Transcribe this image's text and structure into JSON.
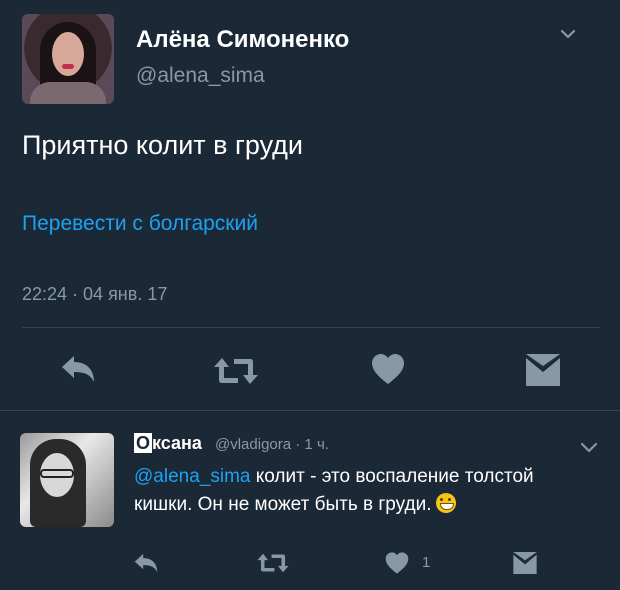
{
  "main_tweet": {
    "author_name": "Алёна Симоненко",
    "author_handle": "@alena_sima",
    "text": "Приятно колит в груди",
    "translate_link": "Перевести с болгарский",
    "timestamp": "22:24 · 04 янв. 17",
    "actions": [
      "reply-icon",
      "retweet-icon",
      "like-icon",
      "direct-message-icon"
    ]
  },
  "reply_tweet": {
    "author_initial": "О",
    "author_name_rest": "ксана",
    "author_handle_time": "@vladigora · 1 ч.",
    "mention": "@alena_sima",
    "text": " колит - это воспаление толстой кишки. Он не может быть в груди.",
    "emoji": "grinning-face",
    "like_count": "1"
  },
  "colors": {
    "background": "#1b2836",
    "text": "#ffffff",
    "muted": "#8899a6",
    "link": "#1da1f2",
    "icon": "#8899a6",
    "divider": "#38444d"
  }
}
